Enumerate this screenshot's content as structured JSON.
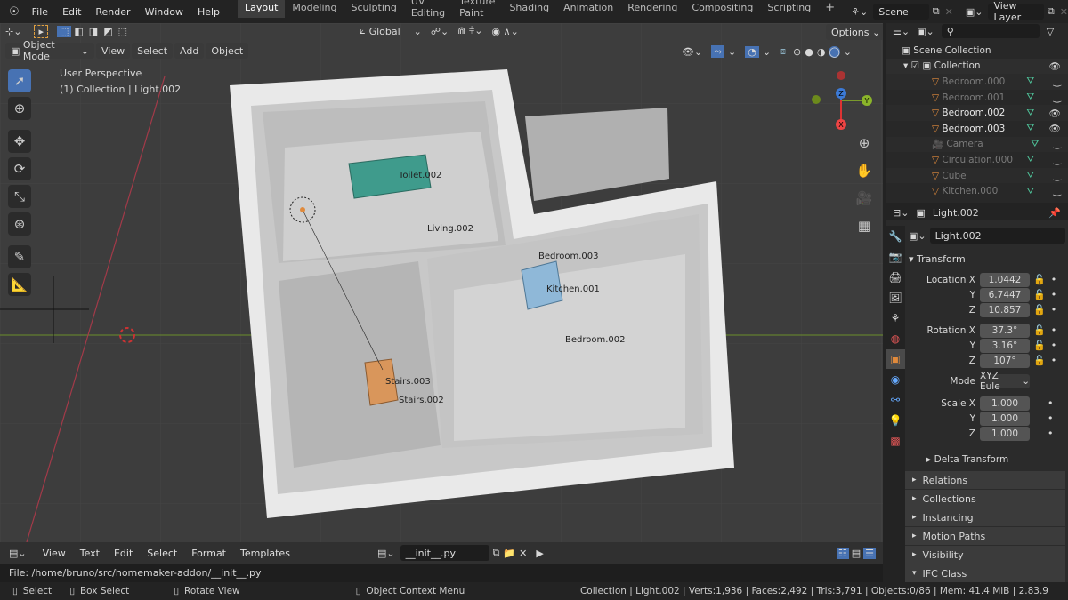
{
  "topbar": {
    "menus": [
      "File",
      "Edit",
      "Render",
      "Window",
      "Help"
    ],
    "workspaces": [
      "Layout",
      "Modeling",
      "Sculpting",
      "UV Editing",
      "Texture Paint",
      "Shading",
      "Animation",
      "Rendering",
      "Compositing",
      "Scripting"
    ],
    "active_workspace": "Layout",
    "add_tab": "+",
    "scene": "Scene",
    "view_layer": "View Layer"
  },
  "viewport": {
    "orientation": "Global",
    "options": "Options",
    "mode": "Object Mode",
    "menus": [
      "View",
      "Select",
      "Add",
      "Object"
    ],
    "overlay_title": "User Perspective",
    "overlay_subtitle": "(1) Collection | Light.002",
    "labels": [
      "Toilet.002",
      "Living.002",
      "Bedroom.003",
      "Kitchen.001",
      "Bedroom.002",
      "Stairs.003",
      "Stairs.002"
    ],
    "axes": {
      "x": "X",
      "y": "Y",
      "z": "Z"
    }
  },
  "outliner": {
    "root": "Scene Collection",
    "collection": "Collection",
    "items": [
      {
        "name": "Bedroom.000",
        "visible": false
      },
      {
        "name": "Bedroom.001",
        "visible": false
      },
      {
        "name": "Bedroom.002",
        "visible": true
      },
      {
        "name": "Bedroom.003",
        "visible": true
      },
      {
        "name": "Camera",
        "visible": false
      },
      {
        "name": "Circulation.000",
        "visible": false
      },
      {
        "name": "Cube",
        "visible": false
      },
      {
        "name": "Kitchen.000",
        "visible": false
      }
    ]
  },
  "properties": {
    "object": "Light.002",
    "name_field": "Light.002",
    "transform": "Transform",
    "location_label": "Location X",
    "location": [
      "1.0442",
      "6.7447",
      "10.857"
    ],
    "rotation_label": "Rotation X",
    "rotation": [
      "37.3°",
      "3.16°",
      "107°"
    ],
    "mode_label": "Mode",
    "mode": "XYZ Eule",
    "scale_label": "Scale X",
    "scale": [
      "1.000",
      "1.000",
      "1.000"
    ],
    "y": "Y",
    "z": "Z",
    "delta": "Delta Transform",
    "panels": [
      "Relations",
      "Collections",
      "Instancing",
      "Motion Paths",
      "Visibility",
      "IFC Class"
    ]
  },
  "text_editor": {
    "menus": [
      "View",
      "Text",
      "Edit",
      "Select",
      "Format",
      "Templates"
    ],
    "file": "__init__.py",
    "path": "File: /home/bruno/src/homemaker-addon/__init__.py"
  },
  "status": {
    "select": "Select",
    "box": "Box Select",
    "rotate": "Rotate View",
    "context": "Object Context Menu",
    "info": "Collection | Light.002 | Verts:1,936 | Faces:2,492 | Tris:3,791 | Objects:0/86 | Mem: 41.4 MiB | 2.83.9"
  },
  "colors": {
    "accent": "#4772b3",
    "x_axis": "#a33a49",
    "y_axis": "#6c8e2c",
    "mesh": "#e08a3c",
    "collection": "#4fc59b"
  }
}
